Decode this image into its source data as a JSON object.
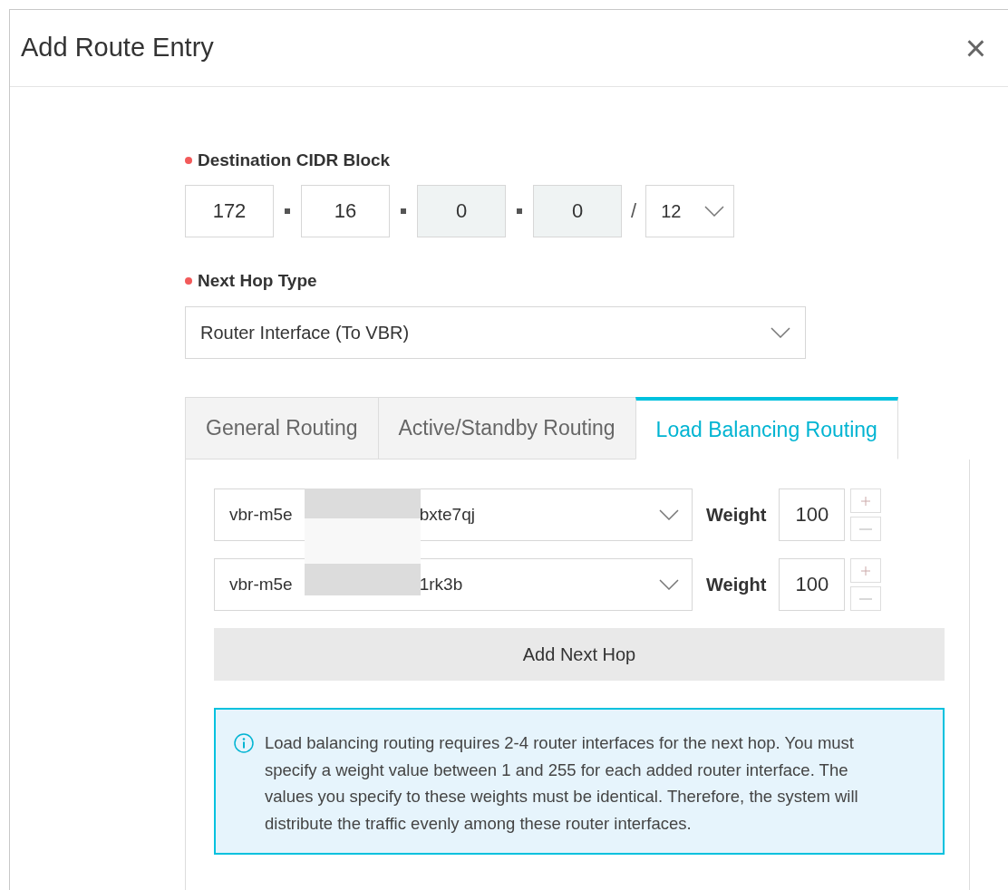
{
  "dialog": {
    "title": "Add Route Entry",
    "close": "×"
  },
  "cidr": {
    "label": "Destination CIDR Block",
    "required": true,
    "octets": [
      {
        "value": "172",
        "disabled": false
      },
      {
        "value": "16",
        "disabled": false
      },
      {
        "value": "0",
        "disabled": true
      },
      {
        "value": "0",
        "disabled": true
      }
    ],
    "separator": "/",
    "prefix": "12"
  },
  "next_hop_type": {
    "label": "Next Hop Type",
    "required": true,
    "value": "Router Interface (To VBR)"
  },
  "tabs": [
    {
      "label": "General Routing",
      "selected": false
    },
    {
      "label": "Active/Standby Routing",
      "selected": false
    },
    {
      "label": "Load Balancing Routing",
      "selected": true
    }
  ],
  "next_hops": [
    {
      "value_start": "vbr-m5e",
      "value_end": "bxte7qj",
      "weight_label": "Weight",
      "weight": "100"
    },
    {
      "value_start": "vbr-m5e",
      "value_end": "1rk3b",
      "weight_label": "Weight",
      "weight": "100"
    }
  ],
  "add_button": "Add Next Hop",
  "info": "Load balancing routing requires 2-4 router interfaces for the next hop. You must specify a weight value between 1 and 255 for each added router interface. The values you specify to these weights must be identical. Therefore, the system will distribute the traffic evenly among these router interfaces."
}
